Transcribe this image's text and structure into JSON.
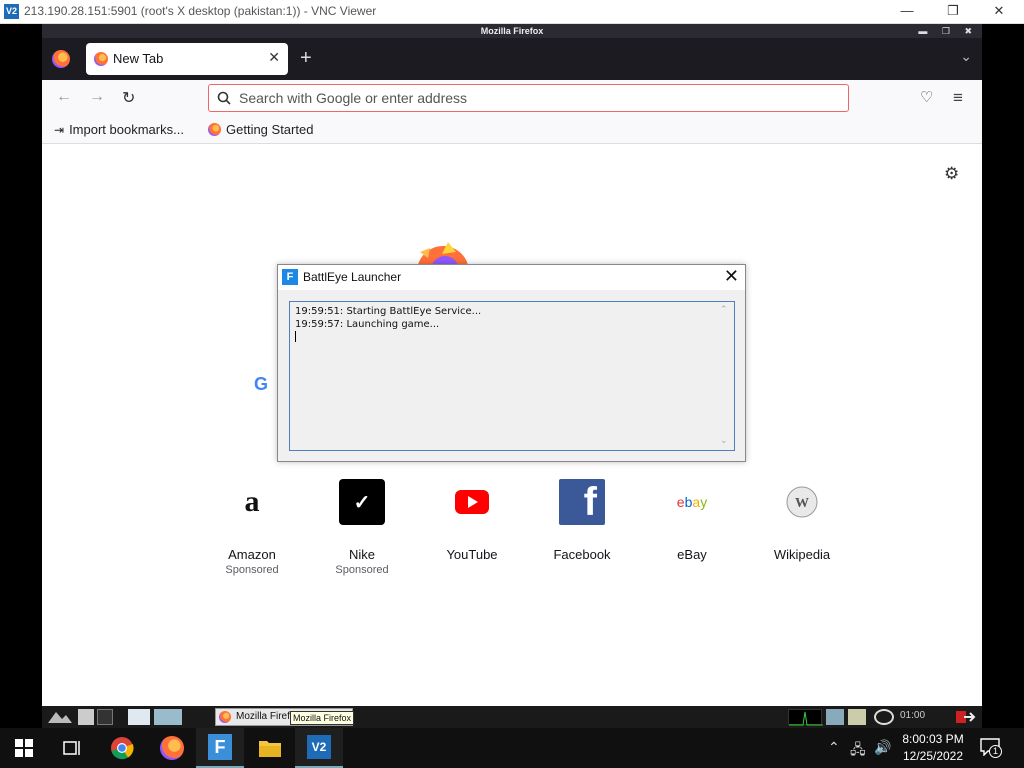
{
  "vnc": {
    "title": "213.190.28.151:5901 (root's X desktop (pakistan:1)) - VNC Viewer",
    "icon_text": "V2",
    "minimize": "—",
    "restore": "❐",
    "close": "✕"
  },
  "firefox": {
    "window_title": "Mozilla Firefox",
    "window_controls": "▬ ❐ ✖",
    "tab": {
      "label": "New Tab",
      "close": "✕"
    },
    "new_tab": "+",
    "tab_list": "⌄",
    "nav": {
      "back": "←",
      "forward": "→",
      "reload": "↻",
      "pocket": "♡",
      "menu": "≡"
    },
    "urlbar": {
      "placeholder": "Search with Google or enter address",
      "value": ""
    },
    "bookmarks": [
      {
        "label": "Import bookmarks...",
        "icon": "import-icon"
      },
      {
        "label": "Getting Started",
        "icon": "firefox-icon"
      }
    ],
    "settings_icon": "⚙",
    "google_g": "G",
    "tiles": [
      {
        "title": "Amazon",
        "sponsored": "Sponsored",
        "icon": "amazon-icon",
        "glyph": "a",
        "bg": "#ffffff",
        "fg": "#111111"
      },
      {
        "title": "Nike",
        "sponsored": "Sponsored",
        "icon": "nike-icon",
        "glyph": "✓",
        "bg": "#000000",
        "fg": "#ffffff"
      },
      {
        "title": "YouTube",
        "sponsored": "",
        "icon": "youtube-icon",
        "glyph": "▶",
        "bg": "#ffffff",
        "fg": "#ff0000"
      },
      {
        "title": "Facebook",
        "sponsored": "",
        "icon": "facebook-icon",
        "glyph": "f",
        "bg": "#3b5998",
        "fg": "#ffffff"
      },
      {
        "title": "eBay",
        "sponsored": "",
        "icon": "ebay-icon",
        "glyph": "ebay",
        "bg": "#ffffff",
        "fg": "#e53238"
      },
      {
        "title": "Wikipedia",
        "sponsored": "",
        "icon": "wikipedia-icon",
        "glyph": "W",
        "bg": "#ffffff",
        "fg": "#777777"
      }
    ]
  },
  "dialog": {
    "title": "BattlEye Launcher",
    "icon_text": "F",
    "close": "✕",
    "log": [
      "19:59:51: Starting BattlEye Service...",
      "19:59:57: Launching game..."
    ]
  },
  "remote_panel": {
    "task_label": "Mozilla Firef",
    "tooltip": "Mozilla Firefox",
    "clock": "01:00"
  },
  "taskbar": {
    "time": "8:00:03 PM",
    "date": "12/25/2022",
    "notification_count": "1",
    "colors": {
      "accent": "#7aaabb"
    }
  }
}
